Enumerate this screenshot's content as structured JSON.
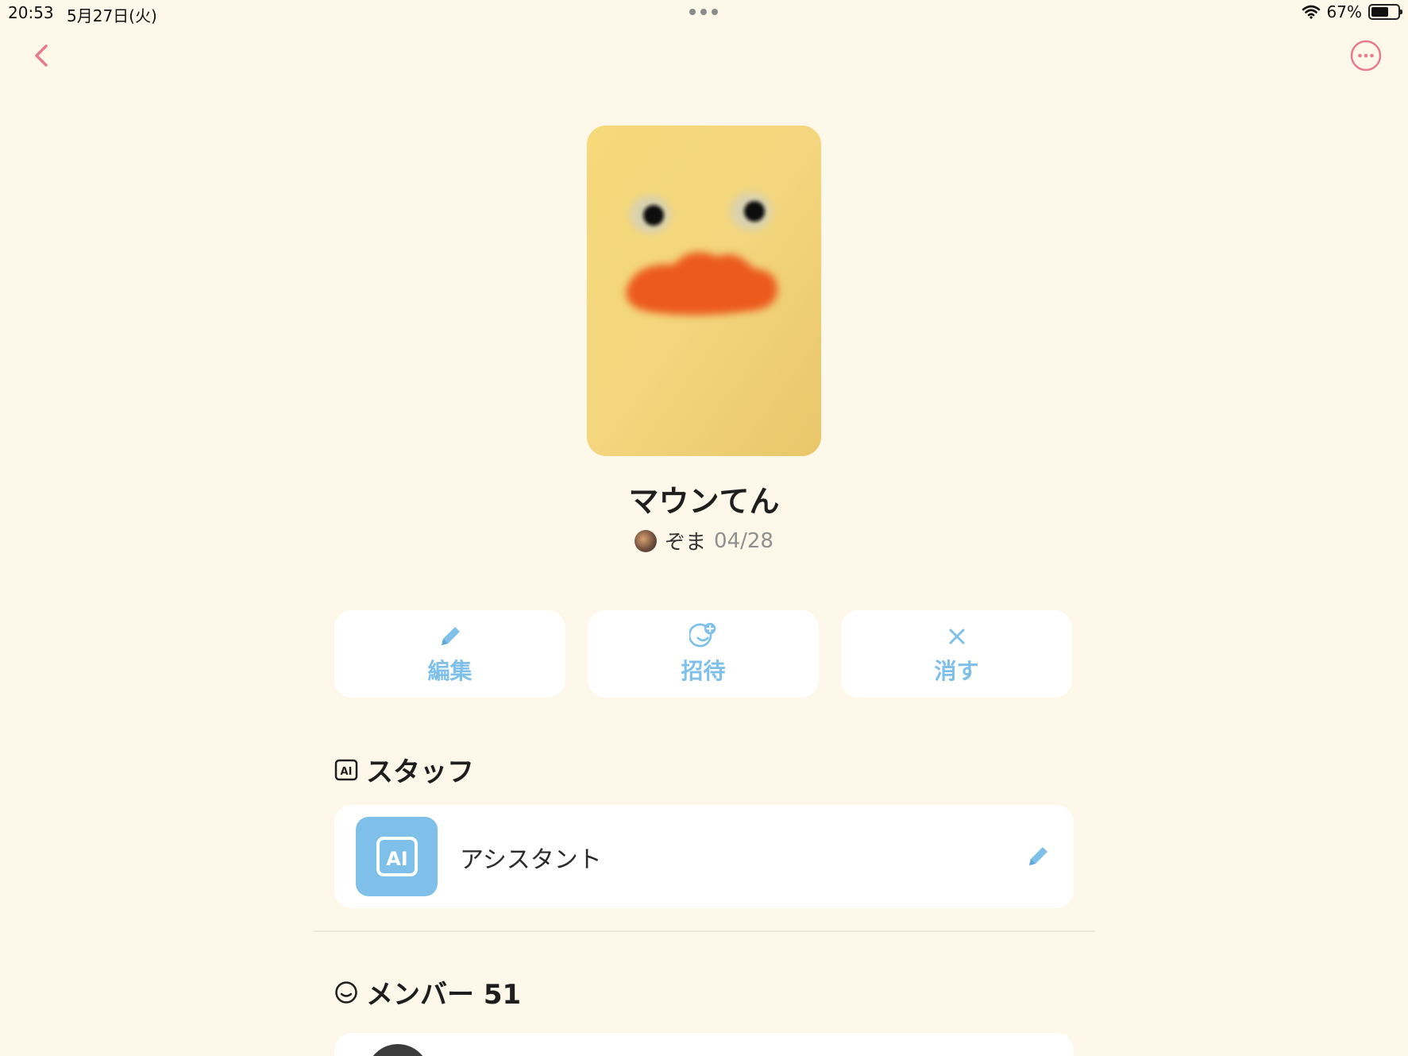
{
  "status_bar": {
    "time": "20:53",
    "date": "5月27日(火)",
    "battery_percent": "67%",
    "battery_level": 0.67
  },
  "nav": {
    "back_icon": "chevron-left-icon",
    "more_icon": "ellipsis-circle-icon",
    "accent_color": "#e87a8c"
  },
  "group": {
    "name": "マウンてん",
    "creator_name": "ぞま",
    "created_date": "04/28"
  },
  "actions": [
    {
      "label": "編集",
      "icon": "pencil-icon"
    },
    {
      "label": "招待",
      "icon": "add-smiley-icon"
    },
    {
      "label": "消す",
      "icon": "close-icon"
    }
  ],
  "staff": {
    "heading": "スタッフ",
    "items": [
      {
        "name": "アシスタント",
        "avatar_text": "AI"
      }
    ]
  },
  "members": {
    "heading": "メンバー 51"
  },
  "colors": {
    "background": "#fdf8ea",
    "accent_blue": "#7ec0ea"
  }
}
